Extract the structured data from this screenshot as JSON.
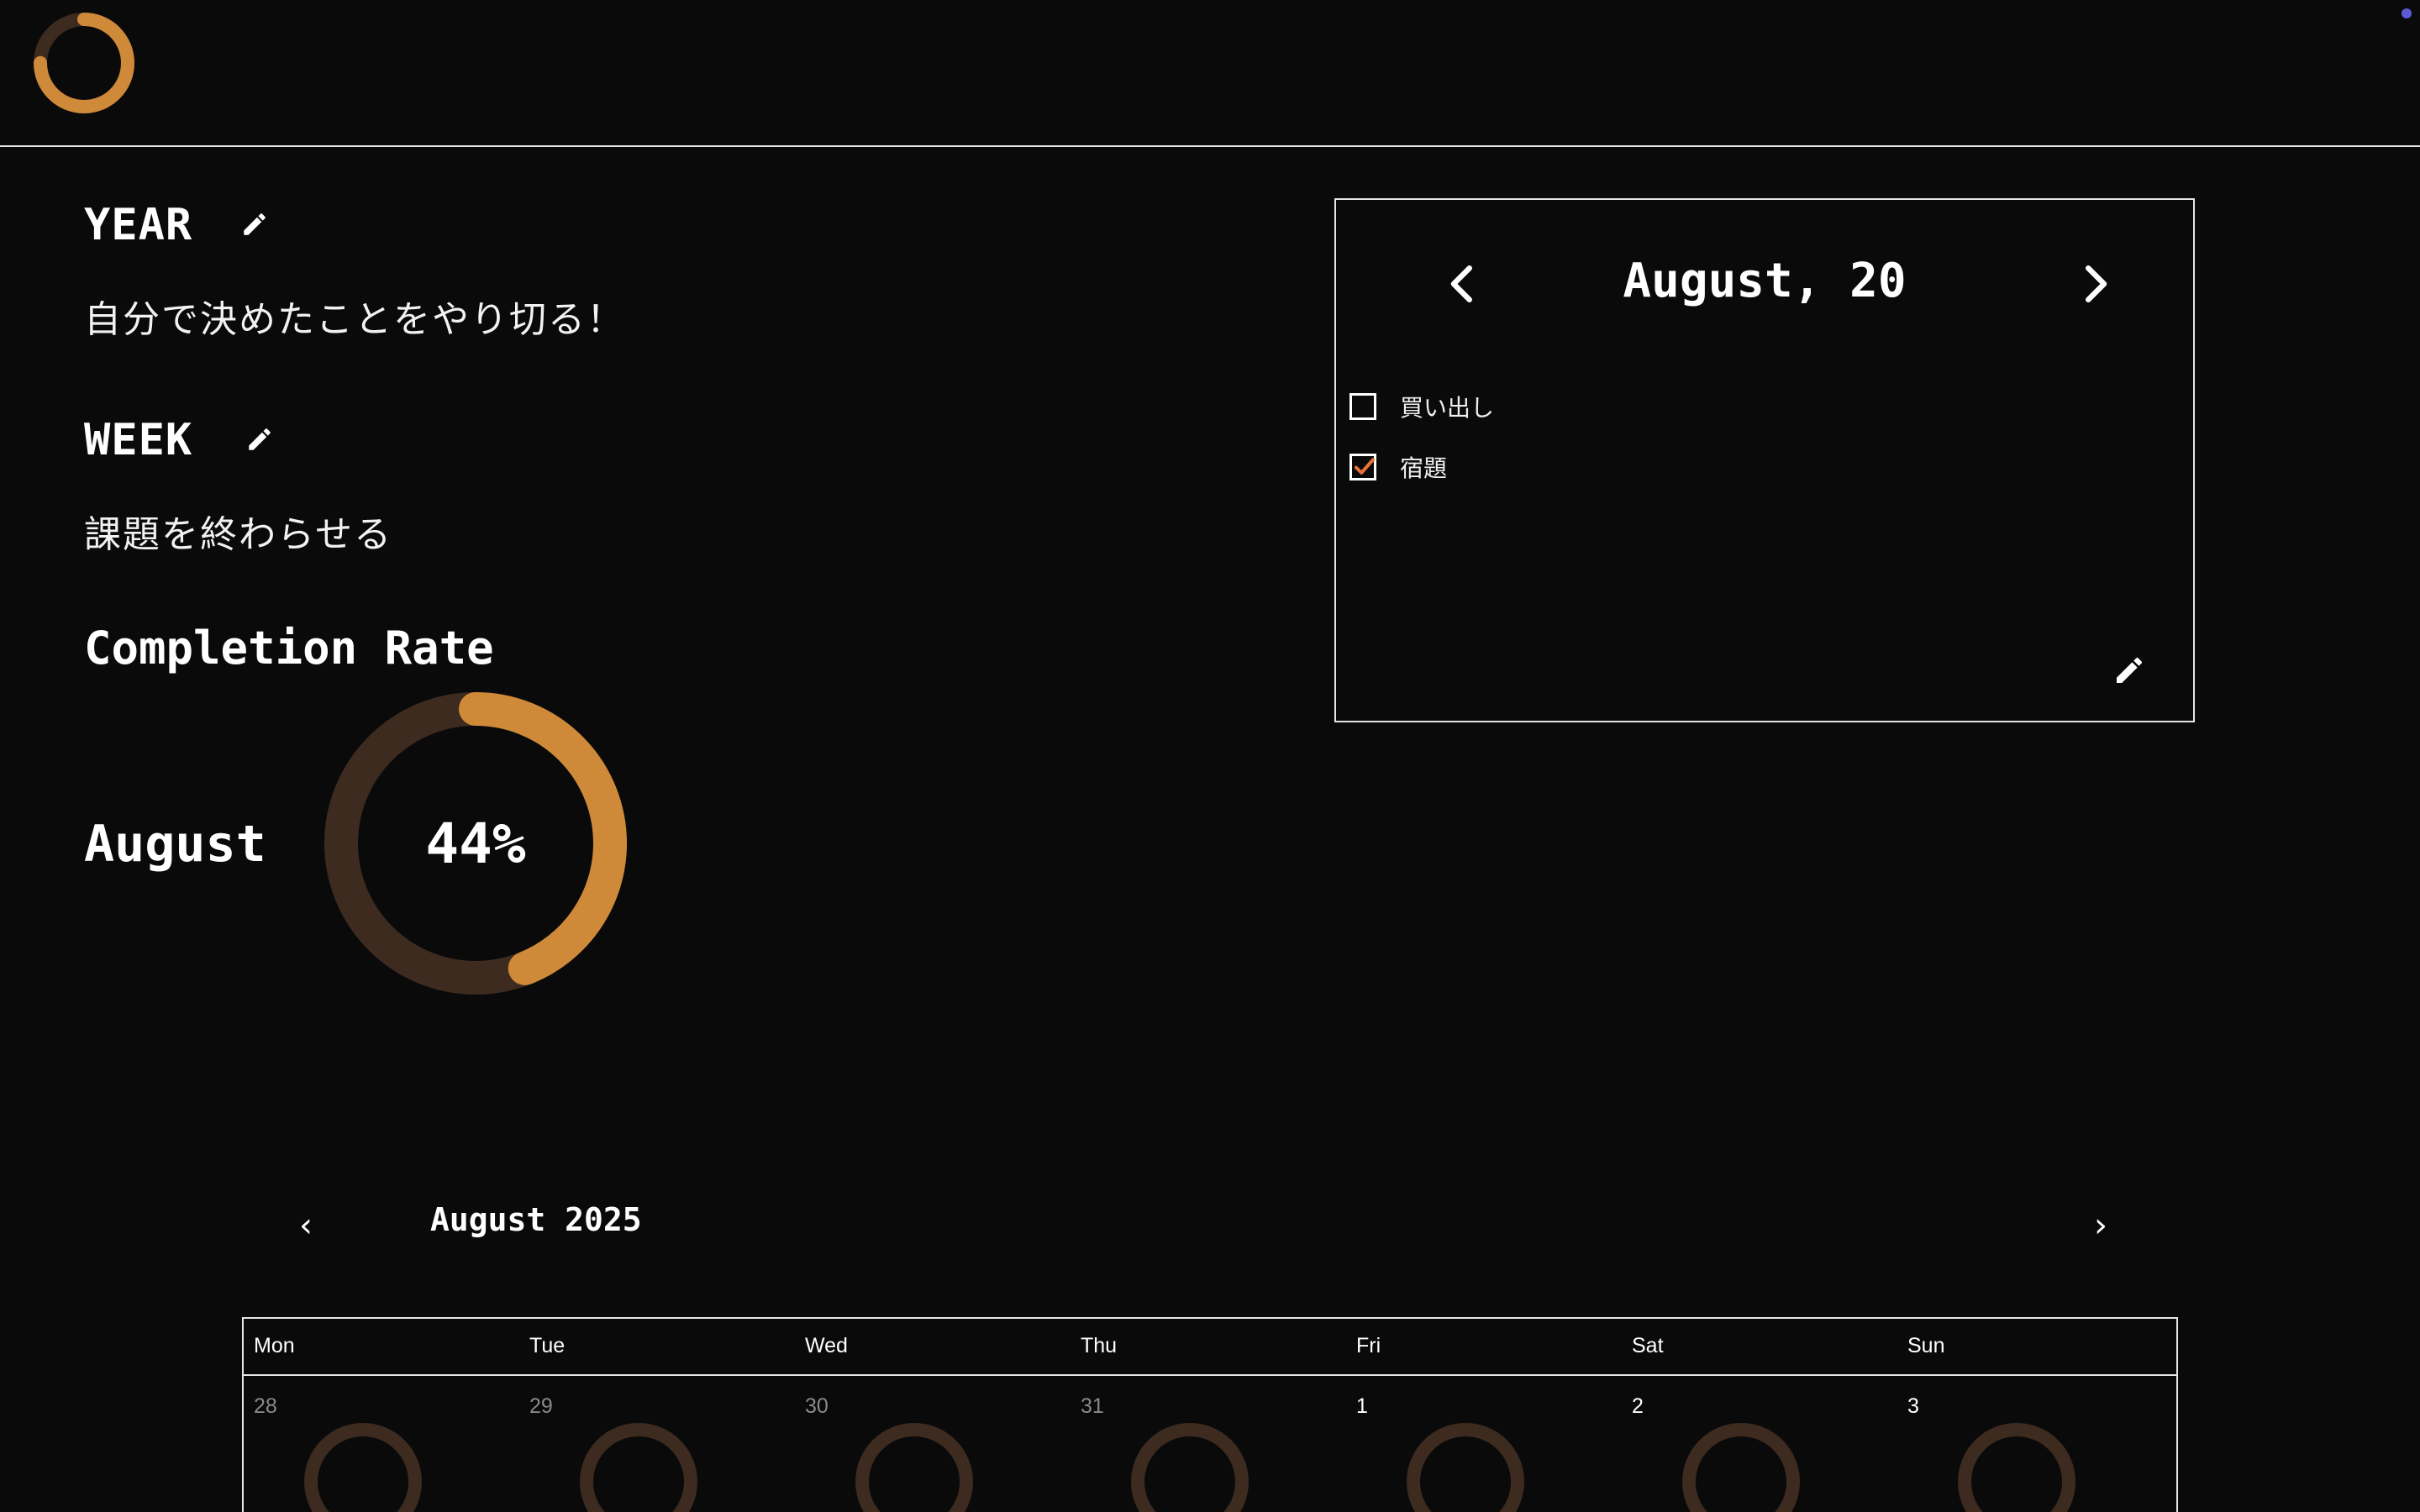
{
  "colors": {
    "background": "#0a0a0b",
    "accent": "#cf8a39",
    "track": "#3d2b1f",
    "check": "#e8733a",
    "text": "#ffffff"
  },
  "header": {
    "logo_icon": "ring-progress-logo"
  },
  "goals": {
    "year": {
      "title": "YEAR",
      "text": "自分で決めたことをやり切る！"
    },
    "week": {
      "title": "WEEK",
      "text": "課題を終わらせる"
    }
  },
  "completion": {
    "title": "Completion Rate",
    "month": "August",
    "percent_label": "44%",
    "percent": 44
  },
  "todo": {
    "date": "August, 20",
    "items": [
      {
        "label": "買い出し",
        "checked": false
      },
      {
        "label": "宿題",
        "checked": true
      }
    ]
  },
  "calendar": {
    "title": "August 2025",
    "prev": "‹",
    "next": "›",
    "weekdays": [
      "Mon",
      "Tue",
      "Wed",
      "Thu",
      "Fri",
      "Sat",
      "Sun"
    ],
    "days": [
      "28",
      "29",
      "30",
      "31",
      "1",
      "2",
      "3"
    ]
  }
}
